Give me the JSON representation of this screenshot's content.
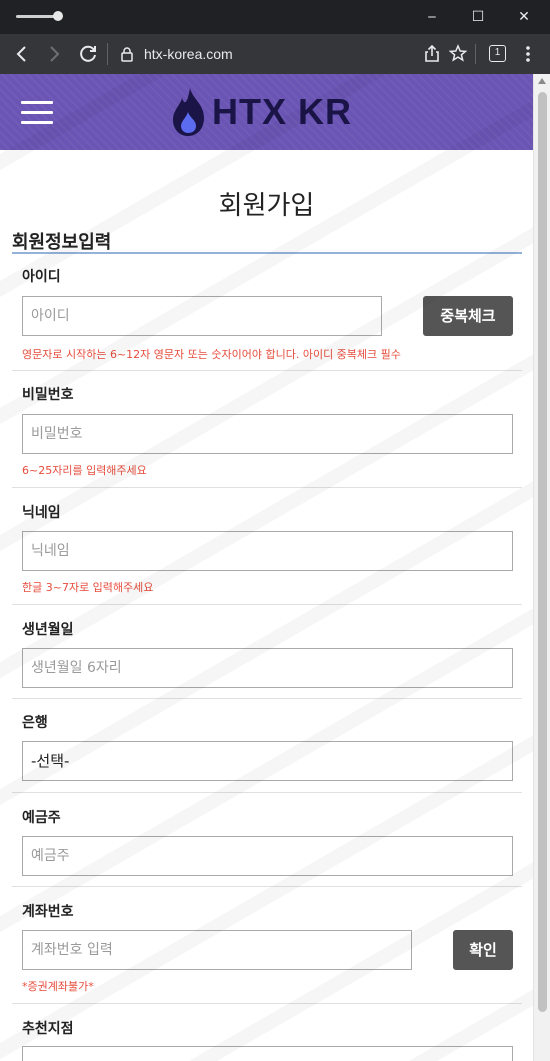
{
  "browser": {
    "url": "htx-korea.com",
    "tab_count": "1",
    "window_controls": {
      "minimize": "‒",
      "maximize": "☐",
      "close": "✕"
    }
  },
  "site": {
    "logo_text": "HTX KR",
    "brand_color": "#6a54b4"
  },
  "page": {
    "title": "회원가입",
    "section_title": "회원정보입력"
  },
  "form": {
    "id": {
      "label": "아이디",
      "placeholder": "아이디",
      "button": "중복체크",
      "hint": "영문자로 시작하는 6~12자 영문자 또는 숫자이어야 합니다. 아이디 중복체크 필수"
    },
    "password": {
      "label": "비밀번호",
      "placeholder": "비밀번호",
      "hint": "6~25자리를 입력해주세요"
    },
    "nickname": {
      "label": "닉네임",
      "placeholder": "닉네임",
      "hint": "한글 3~7자로 입력해주세요"
    },
    "birth": {
      "label": "생년월일",
      "placeholder": "생년월일 6자리"
    },
    "bank": {
      "label": "은행",
      "selected": "-선택-"
    },
    "holder": {
      "label": "예금주",
      "placeholder": "예금주"
    },
    "account": {
      "label": "계좌번호",
      "placeholder": "계좌번호 입력",
      "button": "확인",
      "hint": "*증권계좌불가*"
    },
    "referral": {
      "label": "추천지점"
    }
  },
  "colors": {
    "hint": "#e74c3c",
    "button": "#555555"
  }
}
